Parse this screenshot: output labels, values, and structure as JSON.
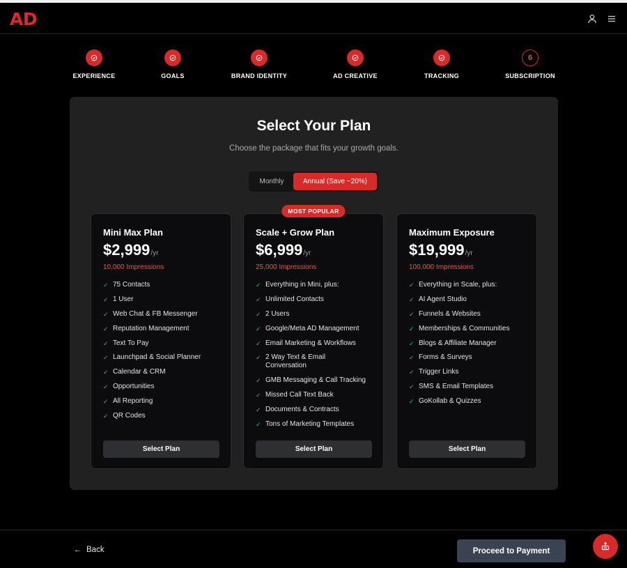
{
  "header": {
    "logo": "AD",
    "user_icon": "user-icon",
    "menu_icon": "menu-icon"
  },
  "steps": [
    {
      "label": "EXPERIENCE",
      "status": "complete"
    },
    {
      "label": "GOALS",
      "status": "complete"
    },
    {
      "label": "BRAND IDENTITY",
      "status": "complete"
    },
    {
      "label": "AD CREATIVE",
      "status": "complete"
    },
    {
      "label": "TRACKING",
      "status": "complete"
    },
    {
      "label": "SUBSCRIPTION",
      "status": "active",
      "number": "6"
    }
  ],
  "main": {
    "title": "Select Your Plan",
    "subtitle": "Choose the package that fits your growth goals.",
    "billing_toggle": {
      "monthly": "Monthly",
      "annual": "Annual (Save ~20%)",
      "selected": "annual"
    }
  },
  "plans": [
    {
      "name": "Mini Max Plan",
      "price": "$2,999",
      "period": "/yr",
      "impressions": "10,000 Impressions",
      "features": [
        "75 Contacts",
        "1 User",
        "Web Chat & FB Messenger",
        "Reputation Management",
        "Text To Pay",
        "Launchpad & Social Planner",
        "Calendar & CRM",
        "Opportunities",
        "All Reporting",
        "QR Codes"
      ],
      "button": "Select Plan"
    },
    {
      "name": "Scale + Grow Plan",
      "badge": "MOST POPULAR",
      "price": "$6,999",
      "period": "/yr",
      "impressions": "25,000 Impressions",
      "features": [
        "Everything in Mini, plus:",
        "Unlimited Contacts",
        "2 Users",
        "Google/Meta AD Management",
        "Email Marketing & Workflows",
        "2 Way Text & Email Conversation",
        "GMB Messaging & Call Tracking",
        "Missed Call Text Back",
        "Documents & Contracts",
        "Tons of Marketing Templates"
      ],
      "button": "Select Plan"
    },
    {
      "name": "Maximum Exposure",
      "price": "$19,999",
      "period": "/yr",
      "impressions": "100,000 Impressions",
      "features": [
        "Everything in Scale, plus:",
        "AI Agent Studio",
        "Funnels & Websites",
        "Memberships & Communities",
        "Blogs & Affiliate Manager",
        "Forms & Surveys",
        "Trigger Links",
        "SMS & Email Templates",
        "GoKollab & Quizzes"
      ],
      "button": "Select Plan"
    }
  ],
  "footer": {
    "back": "Back",
    "proceed": "Proceed to Payment",
    "fab_icon": "support-icon"
  },
  "colors": {
    "accent": "#d92a2a",
    "impressions": "#ef4f4f",
    "check": "#3fb56b",
    "panel": "#212121",
    "card": "#0c0c0e"
  }
}
